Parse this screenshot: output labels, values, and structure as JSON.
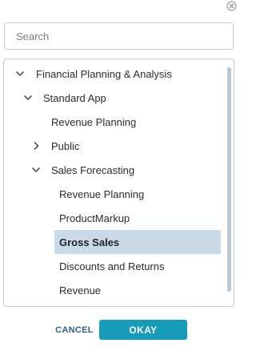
{
  "search": {
    "placeholder": "Search",
    "value": ""
  },
  "tree": {
    "items": [
      {
        "label": "Financial Planning & Analysis",
        "expander": "chevron-down-icon"
      },
      {
        "label": "Standard App",
        "expander": "chevron-down-icon"
      },
      {
        "label": "Revenue Planning",
        "expander": ""
      },
      {
        "label": "Public",
        "expander": "chevron-right-icon"
      },
      {
        "label": "Sales Forecasting",
        "expander": "chevron-down-icon"
      },
      {
        "label": "Revenue Planning",
        "expander": ""
      },
      {
        "label": "ProductMarkup",
        "expander": ""
      },
      {
        "label": "Gross Sales",
        "expander": "",
        "selected": true
      },
      {
        "label": "Discounts and Returns",
        "expander": ""
      },
      {
        "label": "Revenue",
        "expander": ""
      }
    ]
  },
  "footer": {
    "cancel_label": "CANCEL",
    "okay_label": "OKAY"
  },
  "colors": {
    "accent": "#149cb8",
    "selected_row": "#c8dae8",
    "cancel_text": "#2e5f85"
  }
}
